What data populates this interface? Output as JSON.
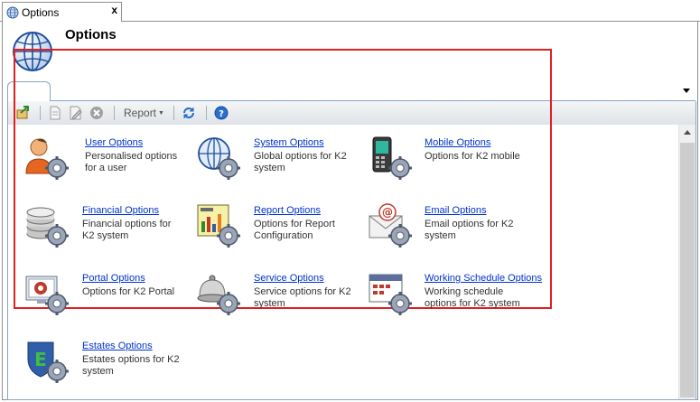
{
  "document_tab": {
    "label": "Options",
    "close": "x"
  },
  "header": {
    "title": "Options"
  },
  "toolbar": {
    "report_label": "Report"
  },
  "options": [
    {
      "key": "user",
      "label": "User Options",
      "description": "Personalised options for a user",
      "icon": "user-gear-icon"
    },
    {
      "key": "system",
      "label": "System Options",
      "description": "Global options for K2 system",
      "icon": "globe-gear-icon"
    },
    {
      "key": "mobile",
      "label": "Mobile Options",
      "description": "Options for K2 mobile",
      "icon": "mobile-gear-icon"
    },
    {
      "key": "financial",
      "label": "Financial Options",
      "description": "Financial options for K2 system",
      "icon": "coins-gear-icon"
    },
    {
      "key": "report",
      "label": "Report Options",
      "description": "Options for Report Configuration",
      "icon": "report-gear-icon"
    },
    {
      "key": "email",
      "label": "Email Options",
      "description": "Email options for K2 system",
      "icon": "email-gear-icon"
    },
    {
      "key": "portal",
      "label": "Portal Options",
      "description": "Options for K2 Portal",
      "icon": "portal-gear-icon"
    },
    {
      "key": "service",
      "label": "Service Options",
      "description": "Service options for K2 system",
      "icon": "bell-gear-icon"
    },
    {
      "key": "working_schedule",
      "label": "Working Schedule Options",
      "description": "Working schedule options for K2 system",
      "icon": "calendar-gear-icon"
    },
    {
      "key": "estates",
      "label": "Estates Options",
      "description": "Estates options for K2 system",
      "icon": "shield-gear-icon"
    }
  ]
}
